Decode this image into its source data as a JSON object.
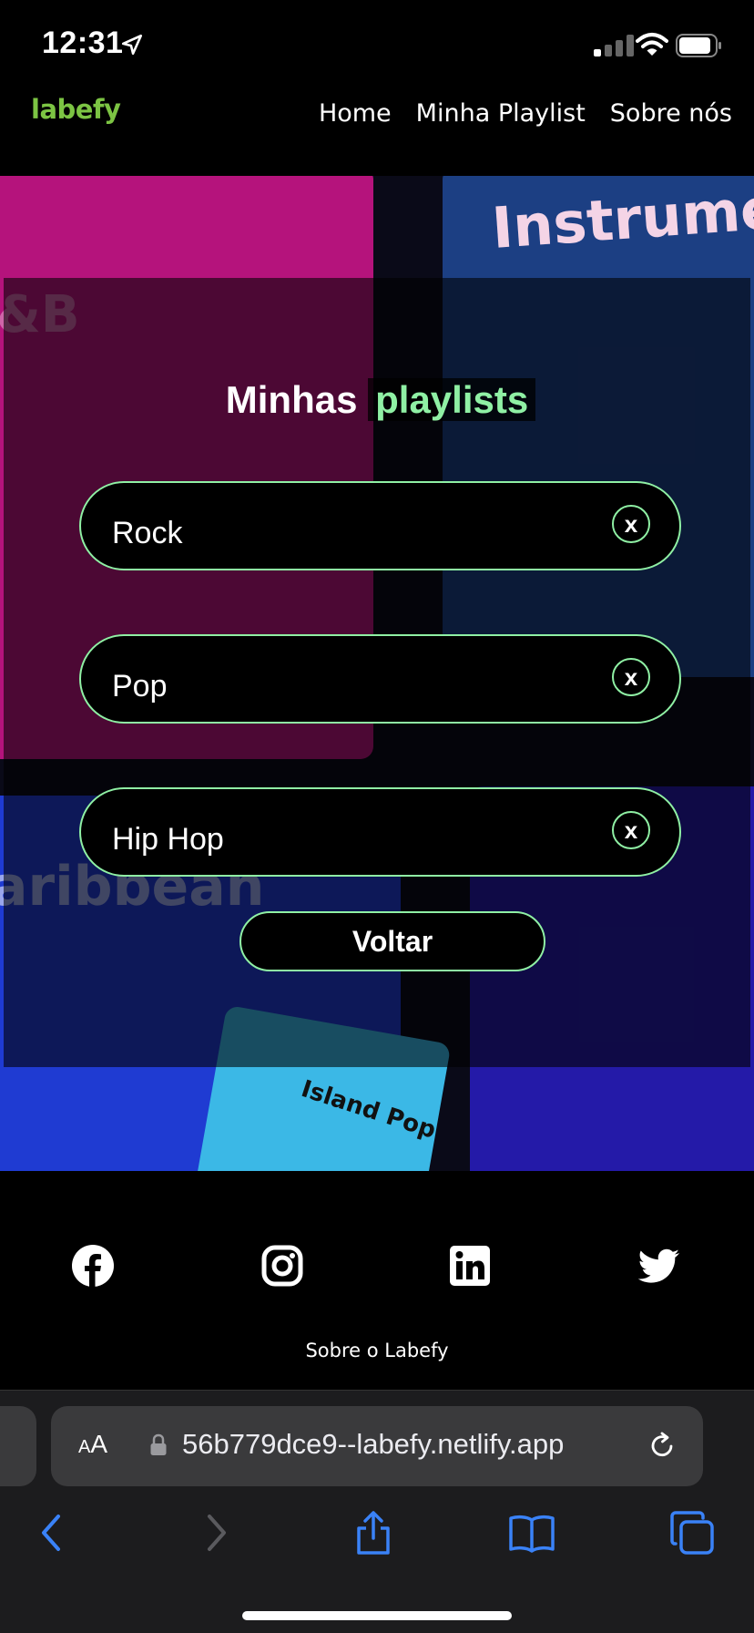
{
  "status": {
    "time": "12:31"
  },
  "nav": {
    "logo": "labefy",
    "links": [
      "Home",
      "Minha Playlist",
      "Sobre nós"
    ]
  },
  "background_words": [
    "Instrume",
    "&B",
    "aribbean",
    "Island Pop"
  ],
  "main": {
    "title_part1": "Minhas",
    "title_part2": "playlists",
    "playlists": [
      {
        "name": "Rock",
        "remove_label": "x"
      },
      {
        "name": "Pop",
        "remove_label": "x"
      },
      {
        "name": "Hip Hop",
        "remove_label": "x"
      }
    ],
    "back_label": "Voltar"
  },
  "footer": {
    "social": [
      "facebook-icon",
      "instagram-icon",
      "linkedin-icon",
      "twitter-icon"
    ],
    "about": "Sobre o Labefy"
  },
  "browser": {
    "text_size_label": "AA",
    "url": "56b779dce9--labefy.netlify.app"
  },
  "colors": {
    "accent": "#8ff0a4",
    "logo": "#7cc443",
    "link_blue": "#3a82f7"
  }
}
